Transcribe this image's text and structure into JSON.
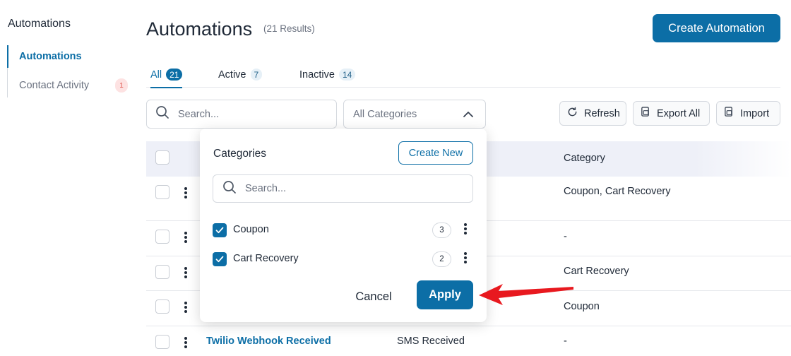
{
  "sidebar": {
    "title": "Automations",
    "items": [
      {
        "label": "Automations"
      },
      {
        "label": "Contact Activity",
        "badge": "1"
      }
    ]
  },
  "header": {
    "title": "Automations",
    "result_count": "(21 Results)",
    "create_button": "Create Automation"
  },
  "tabs": [
    {
      "label": "All",
      "count": "21"
    },
    {
      "label": "Active",
      "count": "7"
    },
    {
      "label": "Inactive",
      "count": "14"
    }
  ],
  "filters": {
    "search_placeholder": "Search...",
    "category_select": "All Categories"
  },
  "toolbar": {
    "refresh": "Refresh",
    "export": "Export All",
    "import": "Import"
  },
  "table": {
    "columns": {
      "category": "Category"
    },
    "rows": [
      {
        "name": "",
        "trigger": "",
        "category": "Coupon, Cart Recovery"
      },
      {
        "name": "",
        "trigger": "",
        "category": "-"
      },
      {
        "name": "",
        "trigger": "",
        "category": "Cart Recovery"
      },
      {
        "name": "",
        "trigger": "",
        "category": "Coupon"
      },
      {
        "name": "Twilio Webhook Received",
        "trigger": "SMS Received",
        "category": "-"
      }
    ]
  },
  "categories_dropdown": {
    "title": "Categories",
    "create_new": "Create New",
    "search_placeholder": "Search...",
    "items": [
      {
        "label": "Coupon",
        "count": "3",
        "checked": true
      },
      {
        "label": "Cart Recovery",
        "count": "2",
        "checked": true
      }
    ],
    "cancel": "Cancel",
    "apply": "Apply"
  },
  "colors": {
    "primary": "#0c6ea6",
    "arrow": "#e8191f"
  }
}
